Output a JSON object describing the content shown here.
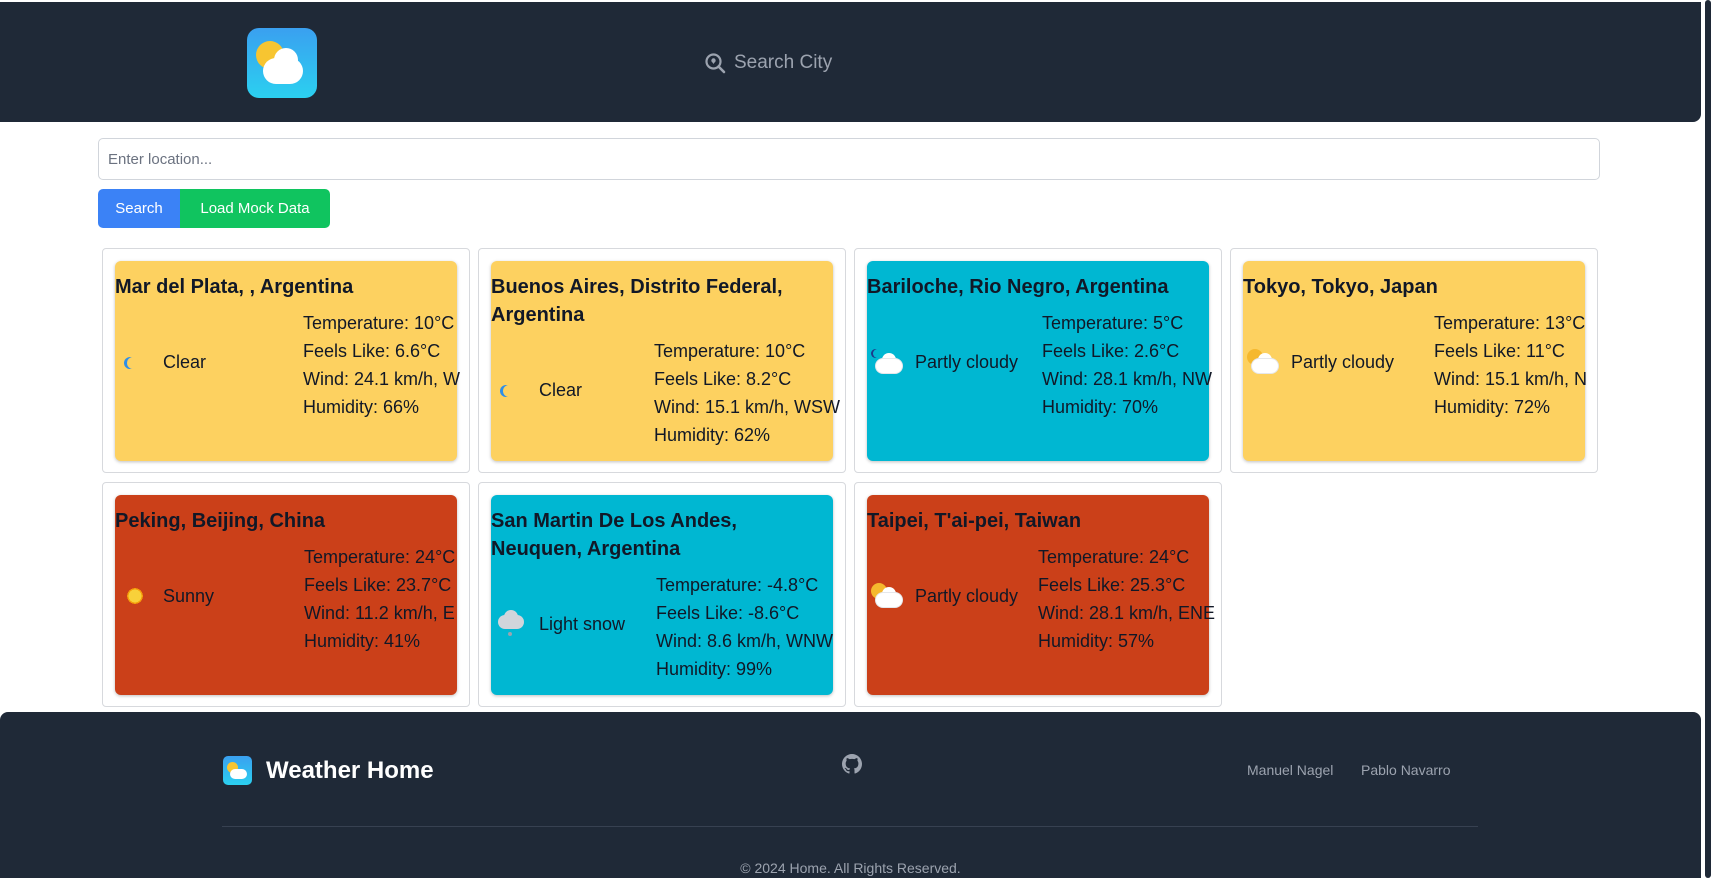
{
  "header": {
    "search_placeholder": "Search City"
  },
  "search": {
    "placeholder": "Enter location...",
    "search_label": "Search",
    "mock_label": "Load Mock Data"
  },
  "cards": [
    {
      "title": "Mar del Plata, , Argentina",
      "condition": "Clear",
      "icon": "moon-icon",
      "bg": "#fdd160",
      "temperature": "Temperature: 10°C",
      "feels_like": "Feels Like: 6.6°C",
      "wind": "Wind: 24.1 km/h, W",
      "humidity": "Humidity: 66%"
    },
    {
      "title": "Buenos Aires, Distrito Federal, Argentina",
      "condition": "Clear",
      "icon": "moon-icon",
      "bg": "#fdd160",
      "temperature": "Temperature: 10°C",
      "feels_like": "Feels Like: 8.2°C",
      "wind": "Wind: 15.1 km/h, WSW",
      "humidity": "Humidity: 62%"
    },
    {
      "title": "Bariloche, Rio Negro, Argentina",
      "condition": "Partly cloudy",
      "icon": "partly-cloudy-night-icon",
      "bg": "#00b7d2",
      "temperature": "Temperature: 5°C",
      "feels_like": "Feels Like: 2.6°C",
      "wind": "Wind: 28.1 km/h, NW",
      "humidity": "Humidity: 70%"
    },
    {
      "title": "Tokyo, Tokyo, Japan",
      "condition": "Partly cloudy",
      "icon": "partly-cloudy-day-icon",
      "bg": "#fdd160",
      "temperature": "Temperature: 13°C",
      "feels_like": "Feels Like: 11°C",
      "wind": "Wind: 15.1 km/h, N",
      "humidity": "Humidity: 72%"
    },
    {
      "title": "Peking, Beijing, China",
      "condition": "Sunny",
      "icon": "sun-icon",
      "bg": "#cb4019",
      "temperature": "Temperature: 24°C",
      "feels_like": "Feels Like: 23.7°C",
      "wind": "Wind: 11.2 km/h, E",
      "humidity": "Humidity: 41%"
    },
    {
      "title": "San Martin De Los Andes, Neuquen, Argentina",
      "condition": "Light snow",
      "icon": "snow-cloud-icon",
      "bg": "#00b7d2",
      "temperature": "Temperature: -4.8°C",
      "feels_like": "Feels Like: -8.6°C",
      "wind": "Wind: 8.6 km/h, WNW",
      "humidity": "Humidity: 99%"
    },
    {
      "title": "Taipei, T'ai-pei, Taiwan",
      "condition": "Partly cloudy",
      "icon": "partly-cloudy-day-icon",
      "bg": "#cb4019",
      "temperature": "Temperature: 24°C",
      "feels_like": "Feels Like: 25.3°C",
      "wind": "Wind: 28.1 km/h, ENE",
      "humidity": "Humidity: 57%"
    }
  ],
  "footer": {
    "title": "Weather Home",
    "links": [
      "Manuel Nagel",
      "Pablo Navarro"
    ],
    "copyright": "© 2024 Home. All Rights Reserved."
  },
  "colors": {
    "nav_bg": "#1f2937",
    "search_button": "#3b82f6",
    "mock_button": "#10c45f"
  }
}
